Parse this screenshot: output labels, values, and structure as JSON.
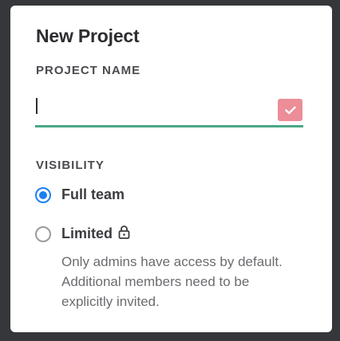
{
  "dialog": {
    "title": "New Project"
  },
  "project_name": {
    "label": "PROJECT NAME",
    "value": "",
    "placeholder": "",
    "check_icon": "check-icon",
    "accent_color": "#4aa786",
    "check_color": "#ec8d98"
  },
  "visibility": {
    "label": "VISIBILITY",
    "selected": "full_team",
    "options": [
      {
        "id": "full_team",
        "label": "Full team",
        "checked": true
      },
      {
        "id": "limited",
        "label": "Limited",
        "checked": false,
        "icon": "lock-icon",
        "description": "Only admins have access by default. Additional members need to be explicitly invited."
      }
    ],
    "radio_color": "#1d7ff2"
  }
}
